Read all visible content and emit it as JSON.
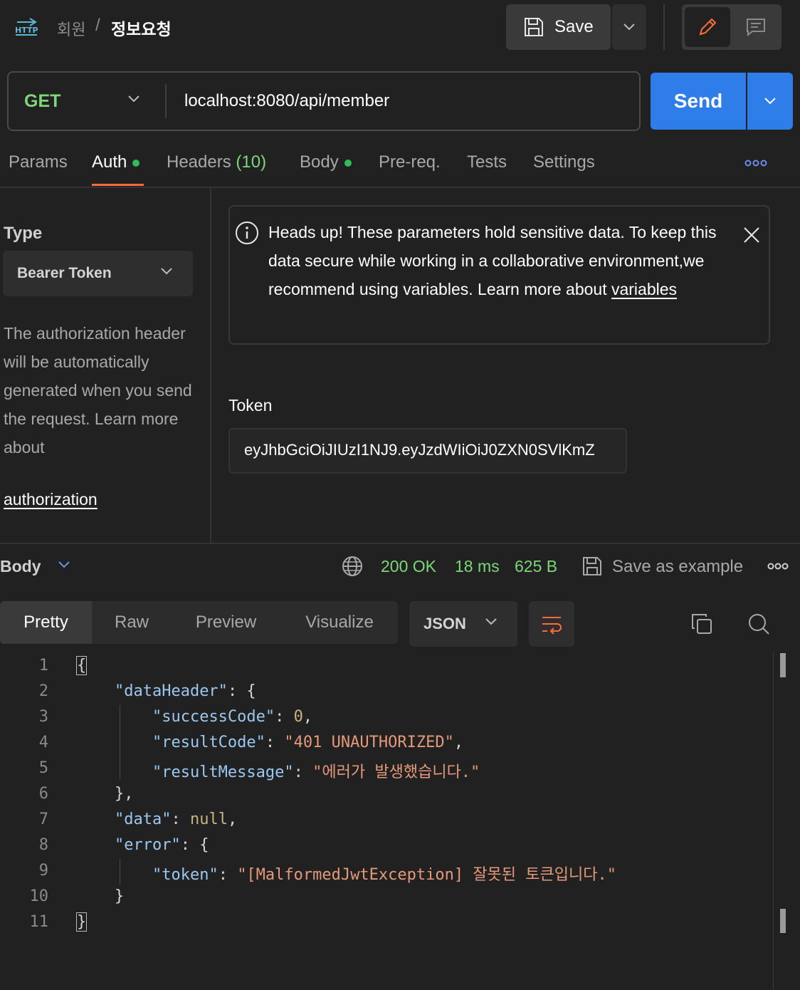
{
  "header": {
    "http_icon_label": "HTTP",
    "breadcrumb_parent": "회원",
    "breadcrumb_separator": "/",
    "breadcrumb_current": "정보요청",
    "save_label": "Save"
  },
  "request": {
    "method": "GET",
    "url": "localhost:8080/api/member",
    "send_label": "Send"
  },
  "tabs": [
    {
      "label": "Params"
    },
    {
      "label": "Auth",
      "dot": true,
      "active": true
    },
    {
      "label": "Headers",
      "count": "(10)"
    },
    {
      "label": "Body",
      "dot": true
    },
    {
      "label": "Pre-req."
    },
    {
      "label": "Tests"
    },
    {
      "label": "Settings"
    }
  ],
  "auth": {
    "type_label": "Type",
    "type_value": "Bearer Token",
    "description": "The authorization header will be automatically generated when you send the request. Learn more about",
    "description_link": "authorization",
    "alert_text": "Heads up! These parameters hold sensitive data. To keep this data secure while working in a collaborative environment,we recommend using variables. Learn more about",
    "alert_link": "variables",
    "token_label": "Token",
    "token_value": "eyJhbGciOiJIUzI1NJ9.eyJzdWIiOiJ0ZXN0SVlKmZ"
  },
  "response": {
    "title": "Body",
    "status": "200 OK",
    "time": "18 ms",
    "size": "625 B",
    "save_example_label": "Save as example",
    "view_tabs": [
      "Pretty",
      "Raw",
      "Preview",
      "Visualize"
    ],
    "format": "JSON",
    "lines": [
      "1",
      "2",
      "3",
      "4",
      "5",
      "6",
      "7",
      "8",
      "9",
      "10",
      "11"
    ],
    "code": {
      "k_dataHeader": "\"dataHeader\"",
      "k_successCode": "\"successCode\"",
      "v_successCode": "0",
      "k_resultCode": "\"resultCode\"",
      "v_resultCode": "\"401 UNAUTHORIZED\"",
      "k_resultMessage": "\"resultMessage\"",
      "v_resultMessage": "\"에러가 발생했습니다.\"",
      "k_data": "\"data\"",
      "v_data": "null",
      "k_error": "\"error\"",
      "k_token": "\"token\"",
      "v_token": "\"[MalformedJwtException] 잘못된 토큰입니다.\""
    }
  },
  "colors": {
    "accent": "#ff6c37",
    "send": "#2e7de9",
    "method": "#7fd67a",
    "status": "#7fd67a"
  }
}
